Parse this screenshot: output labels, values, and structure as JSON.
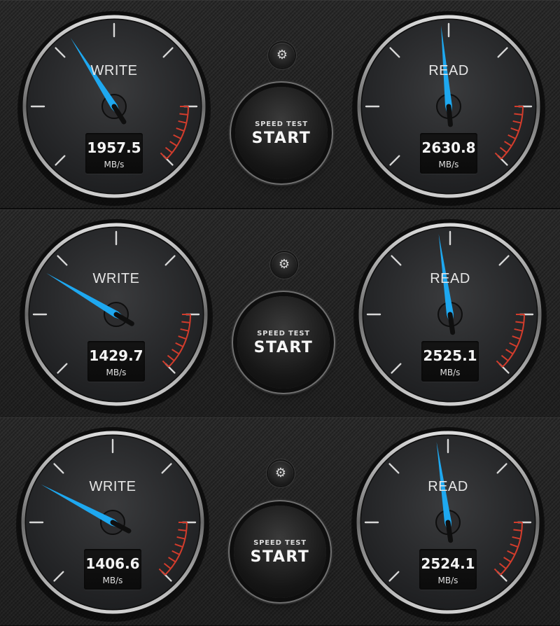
{
  "speed_test_label": "SPEED TEST",
  "start_label": "START",
  "settings_icon": "gear-icon",
  "unit": "MB/s",
  "accent_color": "#1ea8f0",
  "redline_color": "#d23c2c",
  "panels": [
    {
      "write": {
        "label": "WRITE",
        "value": "1957.5",
        "needle_level": 0.38
      },
      "read": {
        "label": "READ",
        "value": "2630.8",
        "needle_level": 0.48
      }
    },
    {
      "write": {
        "label": "WRITE",
        "value": "1429.7",
        "needle_level": 0.28
      },
      "read": {
        "label": "READ",
        "value": "2525.1",
        "needle_level": 0.47
      }
    },
    {
      "write": {
        "label": "WRITE",
        "value": "1406.6",
        "needle_level": 0.27
      },
      "read": {
        "label": "READ",
        "value": "2524.1",
        "needle_level": 0.47
      }
    }
  ]
}
